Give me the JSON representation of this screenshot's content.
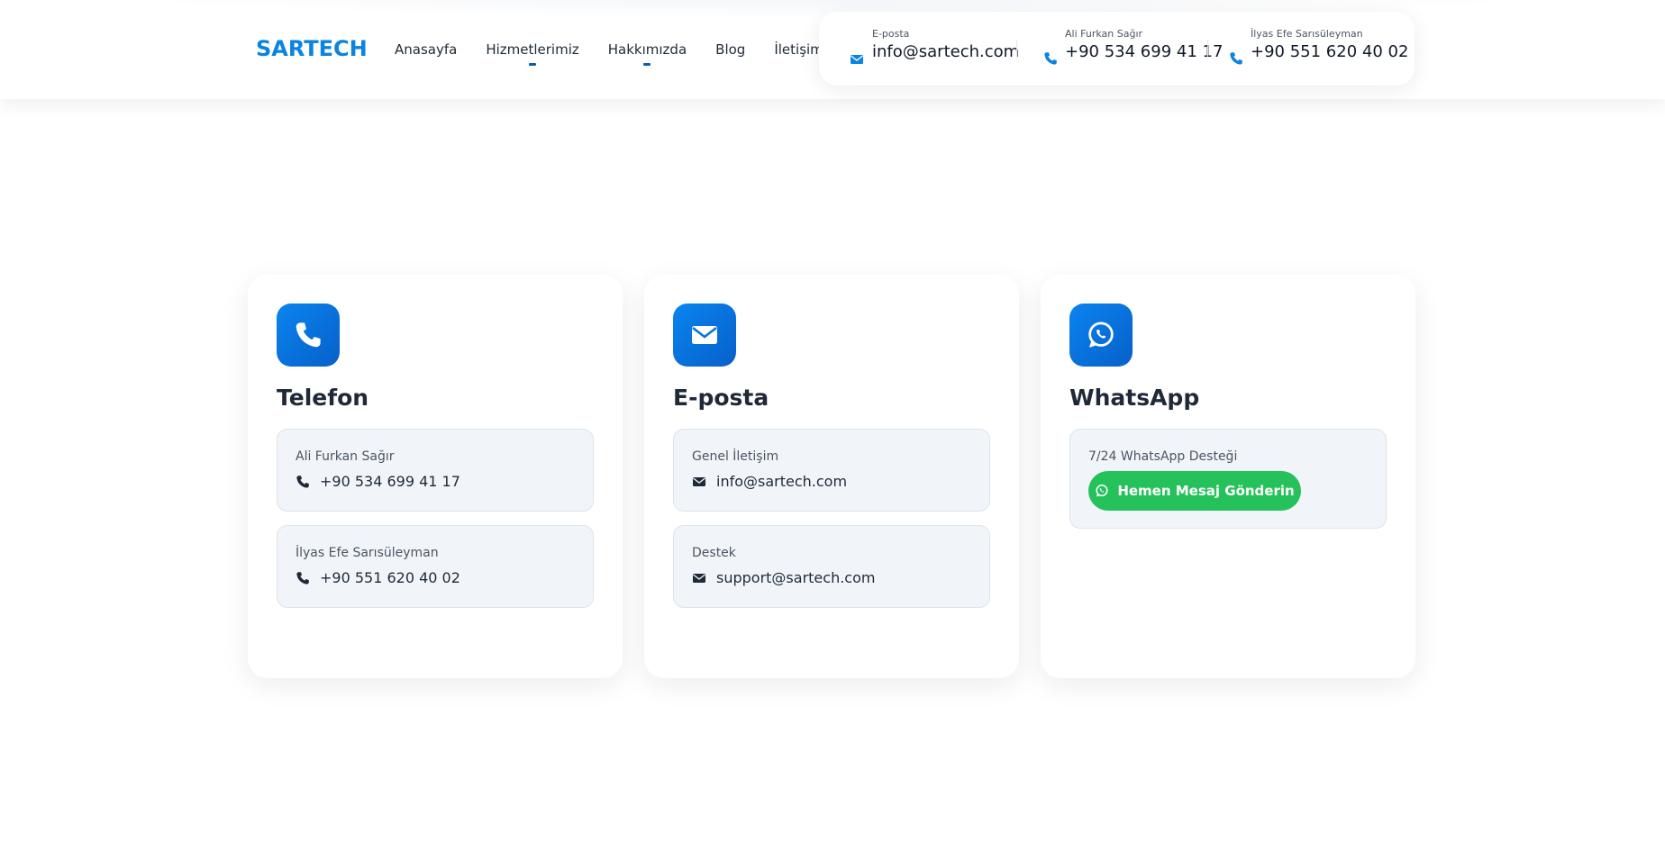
{
  "header": {
    "logo": "SARTECH",
    "nav": [
      {
        "label": "Anasayfa"
      },
      {
        "label": "Hizmetlerimiz"
      },
      {
        "label": "Hakkımızda"
      },
      {
        "label": "Blog"
      },
      {
        "label": "İletişim"
      }
    ],
    "contacts": [
      {
        "label": "E-posta",
        "value": "info@sartech.com",
        "icon": "envelope-icon"
      },
      {
        "label": "Ali Furkan Sağır",
        "value": "+90 534 699 41 17",
        "icon": "phone-icon"
      },
      {
        "label": "İlyas Efe Sarısüleyman",
        "value": "+90 551 620 40 02",
        "icon": "phone-icon"
      }
    ]
  },
  "cards": {
    "phone": {
      "title": "Telefon",
      "icon": "phone-icon",
      "items": [
        {
          "label": "Ali Furkan Sağır",
          "value": "+90 534 699 41 17"
        },
        {
          "label": "İlyas Efe Sarısüleyman",
          "value": "+90 551 620 40 02"
        }
      ]
    },
    "email": {
      "title": "E-posta",
      "icon": "envelope-icon",
      "items": [
        {
          "label": "Genel İletişim",
          "value": "info@sartech.com"
        },
        {
          "label": "Destek",
          "value": "support@sartech.com"
        }
      ]
    },
    "whatsapp": {
      "title": "WhatsApp",
      "icon": "whatsapp-icon",
      "label": "7/24 WhatsApp Desteği",
      "button": "Hemen Mesaj Gönderin"
    }
  },
  "colors": {
    "brand": "#0a84e0",
    "icon_gradient_start": "#0a84f0",
    "icon_gradient_end": "#0760c9",
    "whatsapp_green": "#25c15a",
    "info_box_bg": "#f1f5f9"
  }
}
